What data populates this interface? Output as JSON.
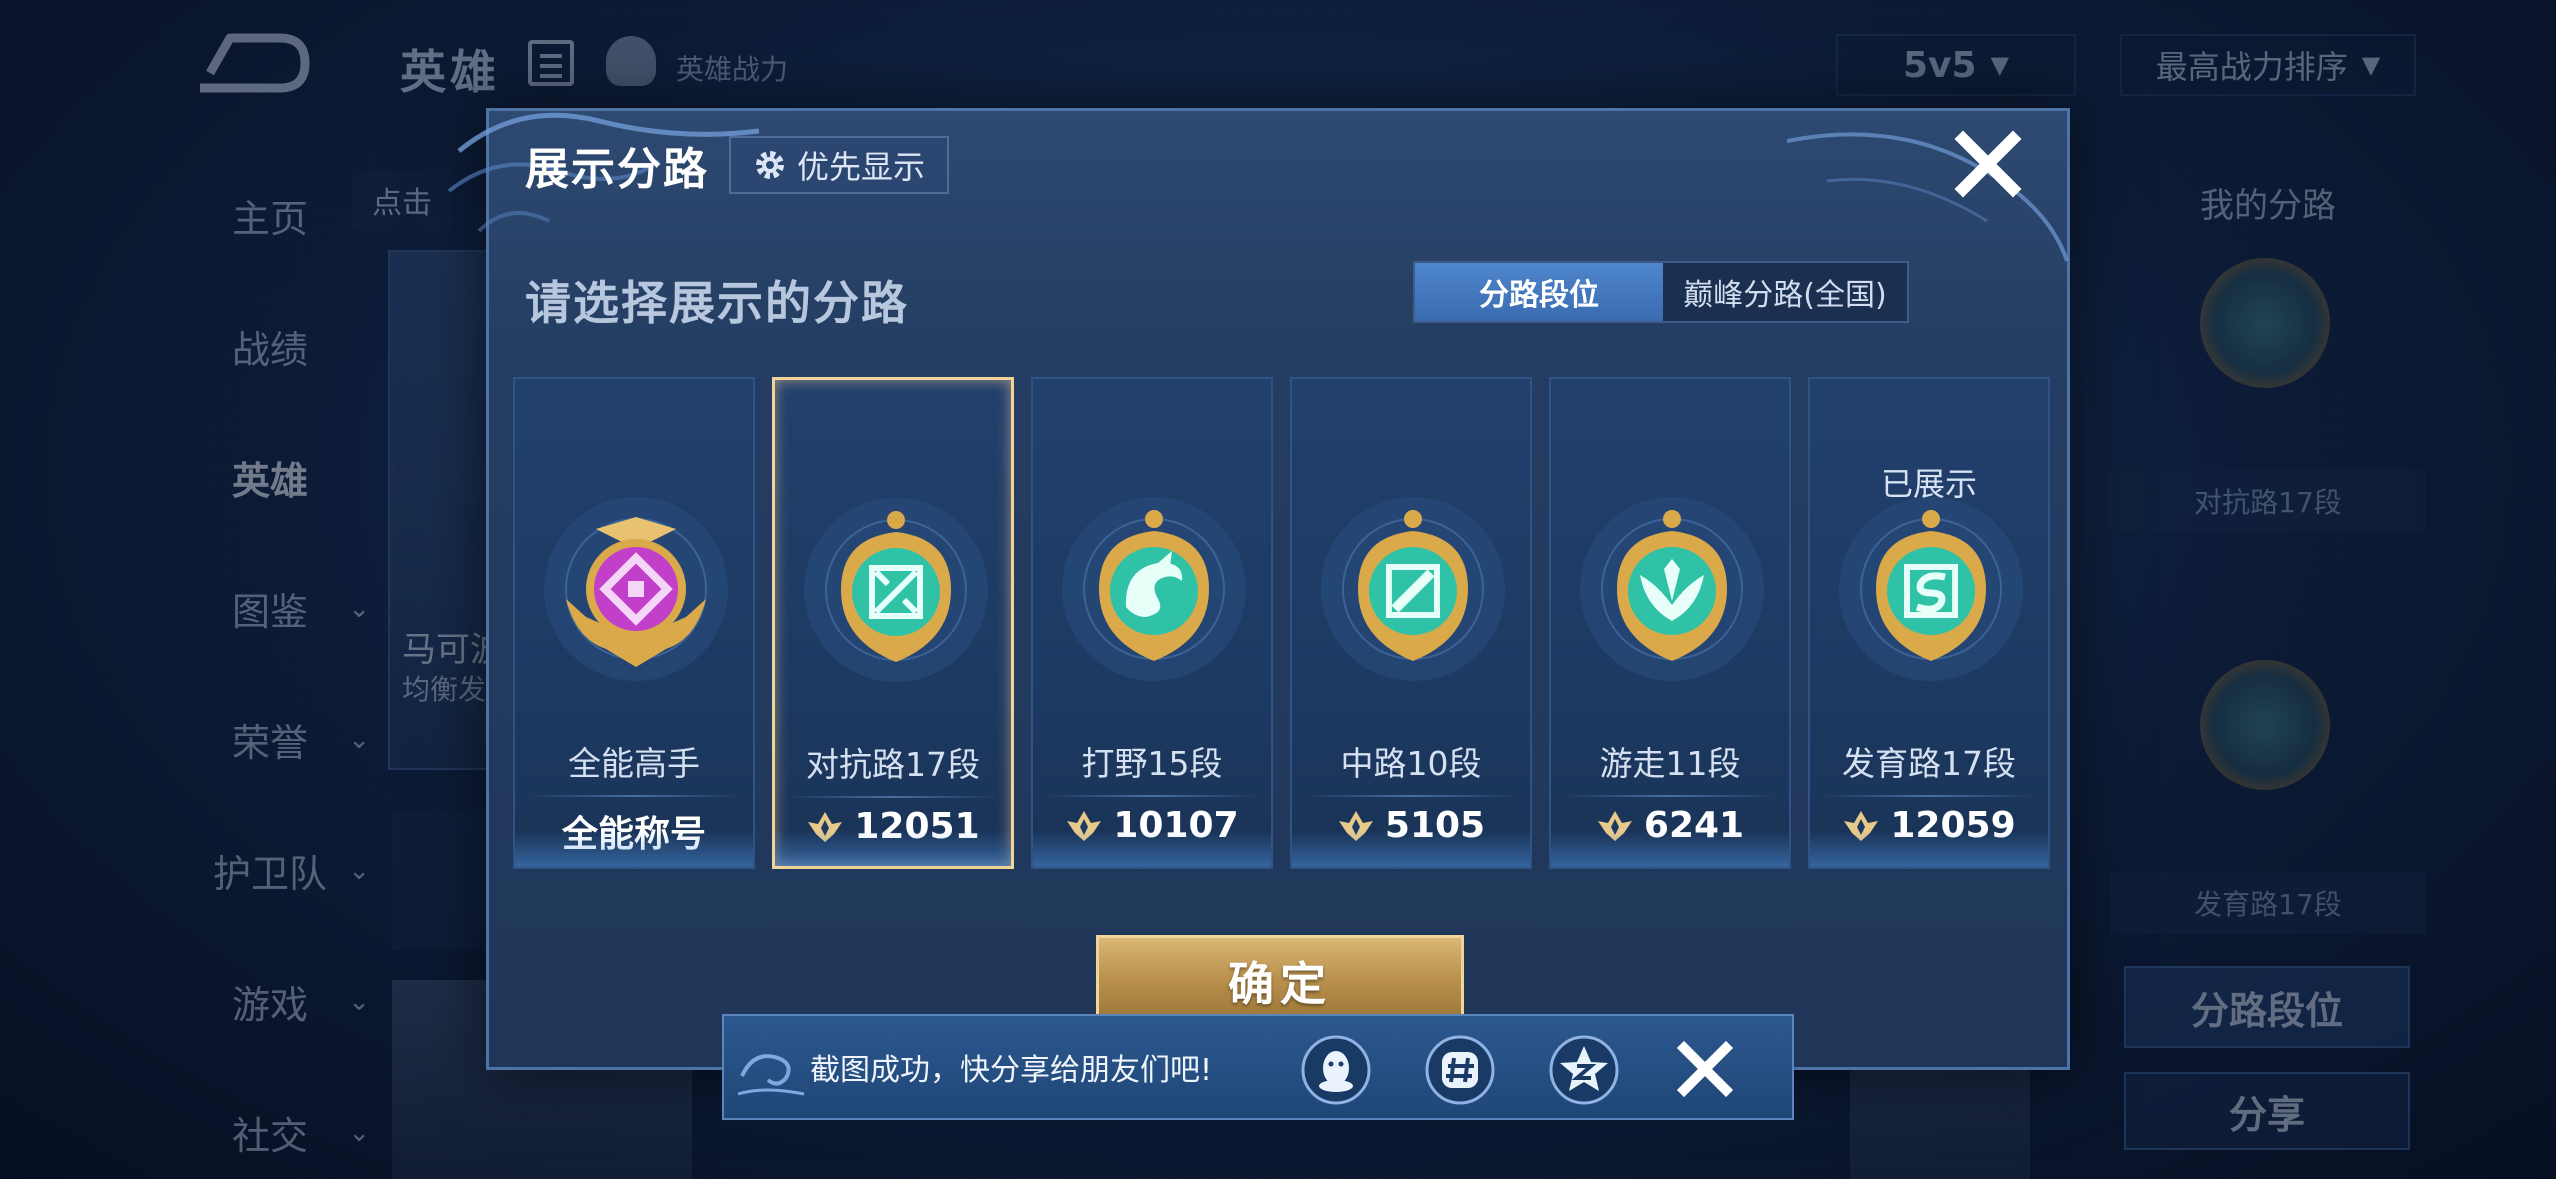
{
  "background": {
    "title": "英雄",
    "subtitle": "英雄战力",
    "mode_select": "5v5",
    "sort_select": "最高战力排序",
    "search_stub": "点击",
    "nav": [
      {
        "label": "主页",
        "has_chevron": false,
        "active": false
      },
      {
        "label": "战绩",
        "has_chevron": false,
        "active": false
      },
      {
        "label": "英雄",
        "has_chevron": false,
        "active": true
      },
      {
        "label": "图鉴",
        "has_chevron": true,
        "active": false
      },
      {
        "label": "荣誉",
        "has_chevron": true,
        "active": false
      },
      {
        "label": "护卫队",
        "has_chevron": true,
        "active": false
      },
      {
        "label": "游戏",
        "has_chevron": true,
        "active": false
      },
      {
        "label": "社交",
        "has_chevron": true,
        "active": false
      }
    ],
    "hero_name": "马可波",
    "hero_type": "均衡发",
    "right_panel": {
      "title": "我的分路",
      "lane_1": "对抗路17段",
      "lane_2": "发育路17段",
      "lane_button": "分路段位",
      "share_button": "分享"
    }
  },
  "modal": {
    "title": "展示分路",
    "priority_label": "优先显示",
    "prompt": "请选择展示的分路",
    "tabs": [
      {
        "label": "分路段位",
        "active": true
      },
      {
        "label": "巅峰分路(全国)",
        "active": false
      }
    ],
    "cards": [
      {
        "name": "全能高手",
        "value": "全能称号",
        "shown_label": "",
        "selected": false,
        "emblem": "allround-emblem-icon",
        "color": "#c23fc9"
      },
      {
        "name": "对抗路17段",
        "value": "12051",
        "shown_label": "",
        "selected": true,
        "emblem": "clash-lane-emblem-icon",
        "color": "#2fc2a6"
      },
      {
        "name": "打野15段",
        "value": "10107",
        "shown_label": "",
        "selected": false,
        "emblem": "jungle-emblem-icon",
        "color": "#2fc2a6"
      },
      {
        "name": "中路10段",
        "value": "5105",
        "shown_label": "",
        "selected": false,
        "emblem": "mid-lane-emblem-icon",
        "color": "#2fc2a6"
      },
      {
        "name": "游走11段",
        "value": "6241",
        "shown_label": "",
        "selected": false,
        "emblem": "roam-emblem-icon",
        "color": "#2fc2a6"
      },
      {
        "name": "发育路17段",
        "value": "12059",
        "shown_label": "已展示",
        "selected": false,
        "emblem": "farm-lane-emblem-icon",
        "color": "#2fc2a6"
      }
    ],
    "confirm_label": "确定"
  },
  "toast": {
    "message": "截图成功，快分享给朋友们吧!",
    "share_targets": [
      "qq-icon",
      "wechat-moments-icon",
      "qzone-icon"
    ]
  },
  "colors": {
    "gold": "#f3d29a",
    "accent_blue": "#4f86cc",
    "modal_bg": "#243d62"
  }
}
